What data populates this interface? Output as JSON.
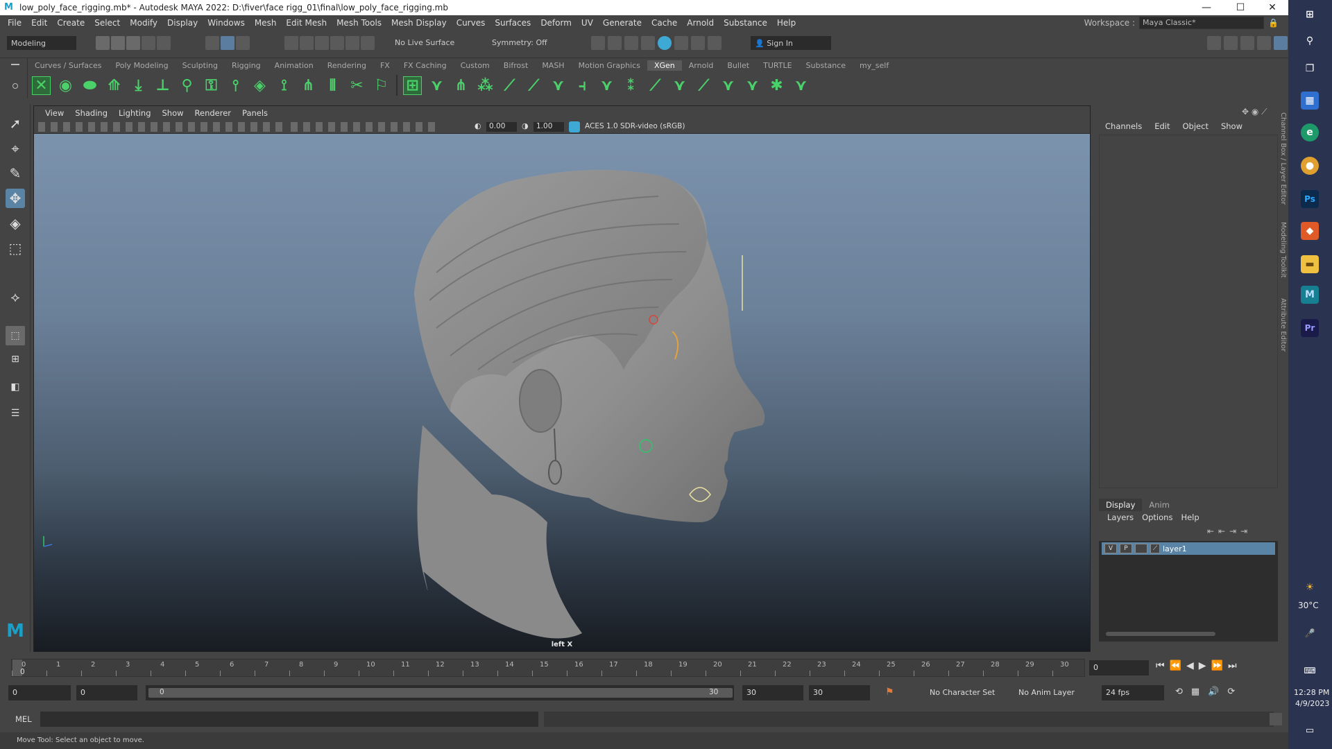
{
  "titlebar": {
    "title": "low_poly_face_rigging.mb* - Autodesk MAYA 2022: D:\\fiver\\face rigg_01\\final\\low_poly_face_rigging.mb",
    "minimize": "—",
    "maximize": "☐",
    "close": "✕"
  },
  "menubar": {
    "items": [
      "File",
      "Edit",
      "Create",
      "Select",
      "Modify",
      "Display",
      "Windows",
      "Mesh",
      "Edit Mesh",
      "Mesh Tools",
      "Mesh Display",
      "Curves",
      "Surfaces",
      "Deform",
      "UV",
      "Generate",
      "Cache",
      "Arnold",
      "Substance",
      "Help"
    ],
    "workspace_label": "Workspace :",
    "workspace_value": "Maya Classic*"
  },
  "statusline": {
    "mode": "Modeling",
    "live_surface": "No Live Surface",
    "symmetry": "Symmetry: Off",
    "sign_in": "Sign In"
  },
  "shelf": {
    "tabs": [
      "Curves / Surfaces",
      "Poly Modeling",
      "Sculpting",
      "Rigging",
      "Animation",
      "Rendering",
      "FX",
      "FX Caching",
      "Custom",
      "Bifrost",
      "MASH",
      "Motion Graphics",
      "XGen",
      "Arnold",
      "Bullet",
      "TURTLE",
      "Substance",
      "my_self"
    ],
    "active_tab": "XGen"
  },
  "viewport": {
    "menu": [
      "View",
      "Shading",
      "Lighting",
      "Show",
      "Renderer",
      "Panels"
    ],
    "exposure": "0.00",
    "gamma": "1.00",
    "color_space": "ACES 1.0 SDR-video (sRGB)",
    "camera_label": "left X"
  },
  "channelbox": {
    "tabs": [
      "Channels",
      "Edit",
      "Object",
      "Show"
    ]
  },
  "layereditor": {
    "tabs": [
      "Display",
      "Anim"
    ],
    "menu": [
      "Layers",
      "Options",
      "Help"
    ],
    "layer": {
      "v": "V",
      "p": "P",
      "name": "layer1"
    }
  },
  "sidetabs": [
    "Channel Box / Layer Editor",
    "Modeling Toolkit",
    "Attribute Editor"
  ],
  "timeslider": {
    "ticks": [
      "0",
      "1",
      "2",
      "3",
      "4",
      "5",
      "6",
      "7",
      "8",
      "9",
      "10",
      "11",
      "12",
      "13",
      "14",
      "15",
      "16",
      "17",
      "18",
      "19",
      "20",
      "21",
      "22",
      "23",
      "24",
      "25",
      "26",
      "27",
      "28",
      "29",
      "30"
    ],
    "current_frame_display": "0",
    "current_frame_field": "0"
  },
  "range": {
    "start": "0",
    "anim_start": "0",
    "range_slider_start": "0",
    "range_slider_end": "30",
    "playback_end": "30",
    "anim_end": "30",
    "character_set": "No Character Set",
    "anim_layer": "No Anim Layer",
    "fps": "24 fps"
  },
  "mel": {
    "label": "MEL"
  },
  "helpline": {
    "text": "Move Tool: Select an object to move."
  },
  "taskbar": {
    "weather": "30°C",
    "time": "12:28 PM",
    "date": "4/9/2023"
  },
  "colors": {
    "accent": "#1aa0c8",
    "shelf_green": "#4bd16a",
    "selected_layer": "#5a84a6",
    "taskbar": "#2a3350"
  }
}
